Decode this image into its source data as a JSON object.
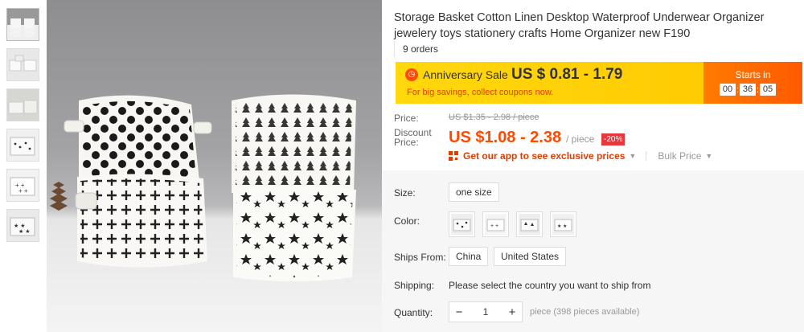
{
  "product": {
    "title": "Storage Basket Cotton Linen Desktop Waterproof Underwear Organizer jewelery toys stationery crafts Home Organizer new F190",
    "orders": "9 orders"
  },
  "thumbnails": [
    {
      "label": "thumb-1"
    },
    {
      "label": "thumb-2"
    },
    {
      "label": "thumb-3"
    },
    {
      "label": "thumb-4"
    },
    {
      "label": "thumb-5"
    },
    {
      "label": "thumb-6"
    }
  ],
  "sale": {
    "icon": "clock-icon",
    "name": "Anniversary Sale",
    "price": "US $ 0.81 - 1.79",
    "sub": "For big savings, collect coupons now.",
    "starts_label": "Starts in",
    "timer": {
      "h": "00",
      "m": "36",
      "s": "05"
    },
    "colors": {
      "banner": "#ffc700",
      "timer_bg": "#ff5a00",
      "accent": "#e23c00"
    }
  },
  "pricing": {
    "price_label": "Price:",
    "old_price": "US $1.35 - 2.98 / piece",
    "discount_label_1": "Discount",
    "discount_label_2": "Price:",
    "discount_price": "US $1.08 - 2.38",
    "per_piece": "/ piece",
    "percent_off": "-20%",
    "app_promo": "Get our app to see exclusive prices",
    "bulk_price": "Bulk Price"
  },
  "specs": {
    "size_label": "Size:",
    "size_value": "one size",
    "color_label": "Color:",
    "color_options": [
      "polka-dot",
      "cross",
      "tree",
      "star"
    ],
    "ships_from_label": "Ships From:",
    "ships_from_options": [
      "China",
      "United States"
    ],
    "shipping_label": "Shipping:",
    "shipping_text": "Please select the country you want to ship from",
    "quantity_label": "Quantity:",
    "quantity_value": "1",
    "quantity_minus": "−",
    "quantity_plus": "+",
    "available": "piece (398 pieces available)"
  }
}
